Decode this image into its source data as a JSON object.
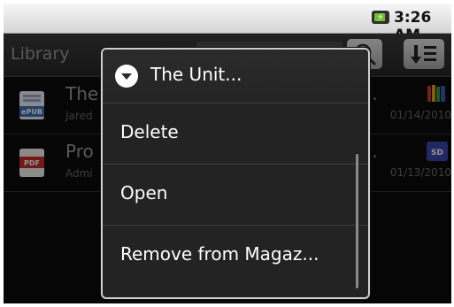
{
  "statusbar": {
    "time": "3:26 AM"
  },
  "toolbar": {
    "title": "Library"
  },
  "rows": [
    {
      "title": "The",
      "author": "Jared",
      "date": "01/14/2010",
      "ellipsis": "..",
      "icon_label": "ePUB"
    },
    {
      "title": "Pro",
      "author": "Admi",
      "date": "01/13/2010",
      "ellipsis": "..",
      "icon_label": "PDF",
      "badge_label": "SD"
    }
  ],
  "menu": {
    "title": "The Unit...",
    "items": [
      "Delete",
      "Open",
      "Remove from Magaz..."
    ]
  },
  "colors": {
    "accent_pdf": "#c62b2b",
    "accent_epub": "#3c6fb5",
    "badge_sd": "#3b44a8"
  }
}
